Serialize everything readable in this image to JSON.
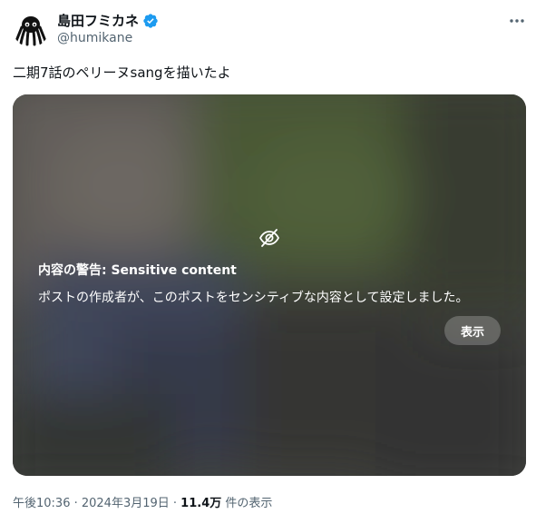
{
  "author": {
    "display_name": "島田フミカネ",
    "handle": "@humikane",
    "avatar_icon": "octopus-icon",
    "verified_icon": "verified-badge-icon"
  },
  "menu": {
    "icon": "more-horizontal-icon"
  },
  "tweet": {
    "text": "二期7話のペリーヌsangを描いたよ"
  },
  "sensitive_warning": {
    "icon": "eye-off-icon",
    "title": "内容の警告: Sensitive content",
    "message": "ポストの作成者が、このポストをセンシティブな内容として設定しました。",
    "show_label": "表示"
  },
  "meta": {
    "time_date": "午後10:36 · 2024年3月19日 ·",
    "views_count": "11.4万",
    "views_label": "件の表示"
  },
  "colors": {
    "text_primary": "#0f1419",
    "text_secondary": "#536471",
    "verified_blue": "#1d9bf0"
  }
}
